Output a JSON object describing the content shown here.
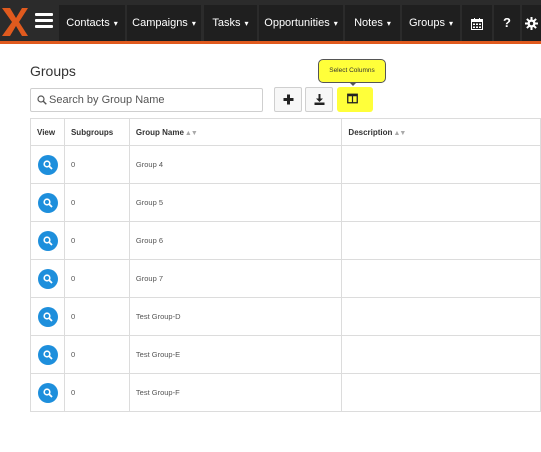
{
  "brand_color": "#e05a1e",
  "nav": {
    "items": [
      {
        "label": "Contacts"
      },
      {
        "label": "Campaigns"
      },
      {
        "label": "Tasks"
      },
      {
        "label": "Opportunities"
      },
      {
        "label": "Notes"
      },
      {
        "label": "Groups"
      }
    ],
    "caret": "▾",
    "icons": [
      "calendar-icon",
      "help-icon",
      "gear-icon"
    ],
    "help_glyph": "?"
  },
  "page": {
    "title": "Groups",
    "search_placeholder": "Search by Group Name",
    "tooltip": "Select Columns"
  },
  "toolbar": {
    "buttons": [
      "add-icon",
      "download-icon",
      "columns-icon"
    ]
  },
  "table": {
    "columns": [
      "View",
      "Subgroups",
      "Group Name",
      "Description"
    ],
    "sort_glyph": "▲▼",
    "rows": [
      {
        "subgroups": "0",
        "name": "Group 4",
        "description": ""
      },
      {
        "subgroups": "0",
        "name": "Group 5",
        "description": ""
      },
      {
        "subgroups": "0",
        "name": "Group 6",
        "description": ""
      },
      {
        "subgroups": "0",
        "name": "Group 7",
        "description": ""
      },
      {
        "subgroups": "0",
        "name": "Test Group-D",
        "description": ""
      },
      {
        "subgroups": "0",
        "name": "Test Group-E",
        "description": ""
      },
      {
        "subgroups": "0",
        "name": "Test Group-F",
        "description": ""
      }
    ]
  }
}
